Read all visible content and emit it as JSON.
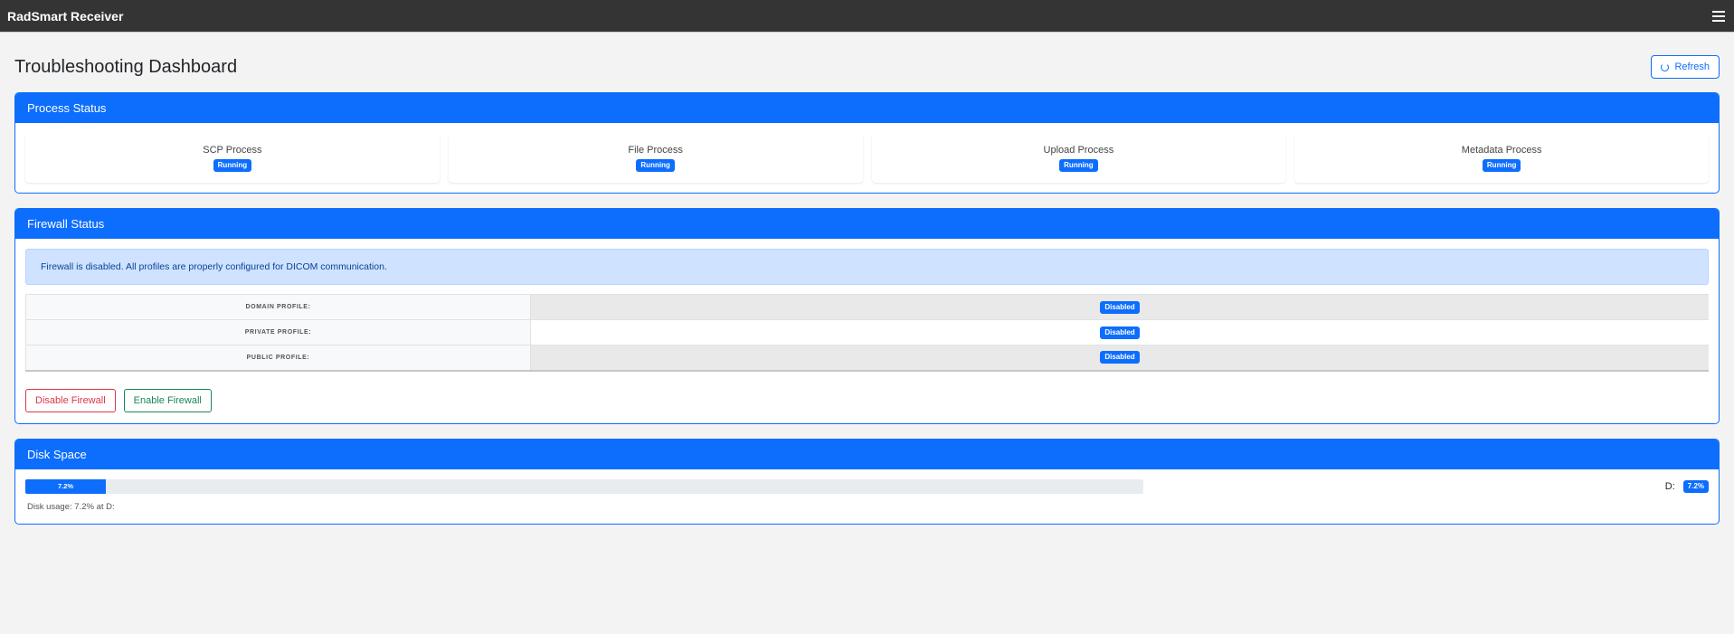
{
  "app": {
    "title": "RadSmart Receiver"
  },
  "page": {
    "title": "Troubleshooting Dashboard",
    "refresh_label": "Refresh"
  },
  "process_status": {
    "title": "Process Status",
    "items": [
      {
        "name": "SCP Process",
        "status": "Running"
      },
      {
        "name": "File Process",
        "status": "Running"
      },
      {
        "name": "Upload Process",
        "status": "Running"
      },
      {
        "name": "Metadata Process",
        "status": "Running"
      }
    ]
  },
  "firewall": {
    "title": "Firewall Status",
    "message": "Firewall is disabled. All profiles are properly configured for DICOM communication.",
    "profiles": [
      {
        "label": "DOMAIN PROFILE:",
        "status": "Disabled"
      },
      {
        "label": "PRIVATE PROFILE:",
        "status": "Disabled"
      },
      {
        "label": "PUBLIC PROFILE:",
        "status": "Disabled"
      }
    ],
    "disable_label": "Disable Firewall",
    "enable_label": "Enable Firewall"
  },
  "disk": {
    "title": "Disk Space",
    "usage_percent": 7.2,
    "usage_label": "7.2%",
    "drive": "D:",
    "badge": "7.2%",
    "note": "Disk usage: 7.2% at D:"
  },
  "colors": {
    "primary": "#0d6efd",
    "danger": "#dc3545",
    "success": "#198754",
    "navbar": "#343434"
  }
}
